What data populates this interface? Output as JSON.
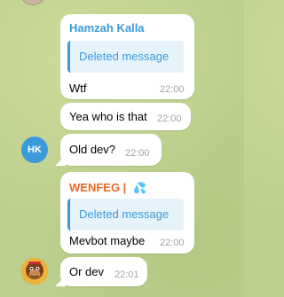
{
  "messages": [
    {
      "sender": "Hamzah Kalla",
      "sender_color": "#3a9ad9",
      "quote": "Deleted message",
      "text": "Wtf",
      "time": "22:00"
    },
    {
      "text": "Yea who is that",
      "time": "22:00"
    },
    {
      "text": "Old dev?",
      "time": "22:00",
      "avatar_initials": "HK"
    },
    {
      "sender": "WENFEG |",
      "sender_color": "#e26a27",
      "quote": "Deleted message",
      "text": "Mevbot maybe",
      "time": "22:00"
    },
    {
      "text": "Or dev",
      "time": "22:01"
    }
  ]
}
